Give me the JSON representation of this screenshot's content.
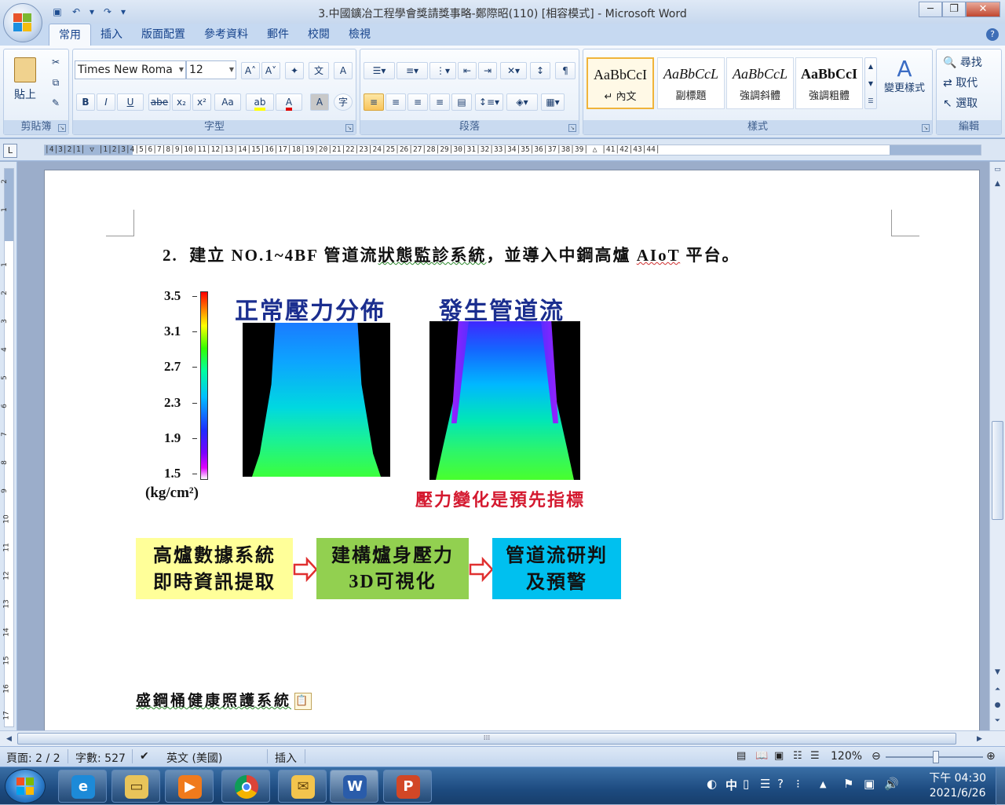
{
  "window": {
    "title": "3.中國鑛冶工程學會獎請獎事略-鄭際昭(110) [相容模式] - Microsoft Word",
    "minimize": "─",
    "restore": "❐",
    "close": "✕"
  },
  "qat": {
    "save_icon": "save-icon",
    "undo_icon": "undo-icon",
    "redo_icon": "redo-icon"
  },
  "tabs": [
    "常用",
    "插入",
    "版面配置",
    "參考資料",
    "郵件",
    "校閱",
    "檢視"
  ],
  "ribbon": {
    "clipboard": {
      "paste_label": "貼上",
      "group_label": "剪貼簿"
    },
    "font": {
      "font_name": "Times New Roma",
      "font_size": "12",
      "group_label": "字型",
      "bold": "B",
      "italic": "I",
      "underline": "U",
      "strike": "abe",
      "sub": "x₂",
      "sup": "x²",
      "case": "Aa",
      "grow": "A˄",
      "shrink": "A˅"
    },
    "paragraph": {
      "group_label": "段落"
    },
    "styles": {
      "group_label": "樣式",
      "items": [
        {
          "sample": "AaBbCcI",
          "name": "↵ 內文"
        },
        {
          "sample": "AaBbCcL",
          "name": "副標題"
        },
        {
          "sample": "AaBbCcL",
          "name": "強調斜體"
        },
        {
          "sample": "AaBbCcI",
          "name": "強調粗體"
        }
      ],
      "change_styles": "變更樣式"
    },
    "editing": {
      "find": "尋找",
      "replace": "取代",
      "select": "選取",
      "group_label": "編輯"
    }
  },
  "document": {
    "heading_number": "2.",
    "heading_pre": "建立 NO.1~4BF 管道流",
    "heading_squig": "狀態監診系統",
    "heading_mid": "，並導入中鋼高爐 ",
    "heading_aiot": "AIoT",
    "heading_post": " 平台。",
    "figure": {
      "scale_ticks": [
        "3.5",
        "3.1",
        "2.7",
        "2.3",
        "1.9",
        "1.5"
      ],
      "unit": "(kg/cm²)",
      "label_normal": "正常壓力分佈",
      "label_channel": "發生管道流",
      "red_note": "壓力變化是預先指標"
    },
    "flow": {
      "box1_line1": "高爐數據系統",
      "box1_line2": "即時資訊提取",
      "box2_line1": "建構爐身壓力",
      "box2_line2": "3D可視化",
      "box3_line1": "管道流研判",
      "box3_line2": "及預警",
      "colors": {
        "box1": "#ffff99",
        "box2": "#92d050",
        "box3": "#00c0ef",
        "arrow": "#e03030"
      }
    },
    "last_line": "盛鋼桶健康照護系統"
  },
  "ruler": {
    "h_text": "│4│3│2│1│ ▽ │1│2│3│4│5│6│7│8│9│10│11│12│13│14│15│16│17│18│19│20│21│22│23│24│25│26│27│28│29│30│31│32│33│34│35│36│37│38│39│ △ │41│42│43│44│",
    "v_numbers": [
      "2",
      "1",
      "1",
      "2",
      "3",
      "4",
      "5",
      "6",
      "7",
      "8",
      "9",
      "10",
      "11",
      "12",
      "13",
      "14",
      "15",
      "16",
      "17"
    ]
  },
  "status": {
    "page": "頁面: 2 / 2",
    "words": "字數: 527",
    "language": "英文 (美國)",
    "mode": "插入",
    "zoom": "120%"
  },
  "taskbar": {
    "ime": "中",
    "time": "下午 04:30",
    "date": "2021/6/26"
  }
}
